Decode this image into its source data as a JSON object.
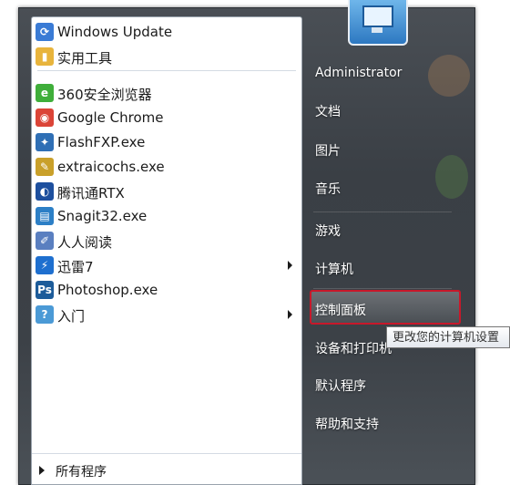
{
  "left_menu": {
    "items": [
      {
        "label": "Windows Update",
        "icon": "windows-update-icon",
        "color": "#3a7bd5",
        "has_arrow": false
      },
      {
        "label": "实用工具",
        "icon": "folder-icon",
        "color": "#e8b43c",
        "has_arrow": false
      },
      {
        "label": "360安全浏览器",
        "icon": "360-browser-icon",
        "color": "#3fae3a",
        "has_arrow": false
      },
      {
        "label": "Google Chrome",
        "icon": "chrome-icon",
        "color": "#db4437",
        "has_arrow": false
      },
      {
        "label": "FlashFXP.exe",
        "icon": "flashfxp-icon",
        "color": "#2f6fb5",
        "has_arrow": false
      },
      {
        "label": "extraicochs.exe",
        "icon": "extraicochs-icon",
        "color": "#c9a02a",
        "has_arrow": false
      },
      {
        "label": "腾讯通RTX",
        "icon": "rtx-icon",
        "color": "#1d4f9e",
        "has_arrow": false
      },
      {
        "label": "Snagit32.exe",
        "icon": "snagit-icon",
        "color": "#2c7fc6",
        "has_arrow": false
      },
      {
        "label": "人人阅读",
        "icon": "renren-reader-icon",
        "color": "#5a7fc0",
        "has_arrow": false
      },
      {
        "label": "迅雷7",
        "icon": "xunlei-icon",
        "color": "#1e6fcf",
        "has_arrow": true
      },
      {
        "label": "Photoshop.exe",
        "icon": "photoshop-icon",
        "color": "#1d5c9a",
        "has_arrow": false
      },
      {
        "label": "入门",
        "icon": "getting-started-icon",
        "color": "#4b9ad6",
        "has_arrow": true
      }
    ],
    "all_programs_label": "所有程序"
  },
  "right_menu": {
    "username": "Administrator",
    "items": [
      "文档",
      "图片",
      "音乐",
      "游戏",
      "计算机",
      "控制面板",
      "设备和打印机",
      "默认程序",
      "帮助和支持"
    ],
    "highlighted": "控制面板"
  },
  "tooltip": "更改您的计算机设置",
  "colors": {
    "highlight_border": "#c8182a",
    "menu_bg": "#3c4147"
  }
}
